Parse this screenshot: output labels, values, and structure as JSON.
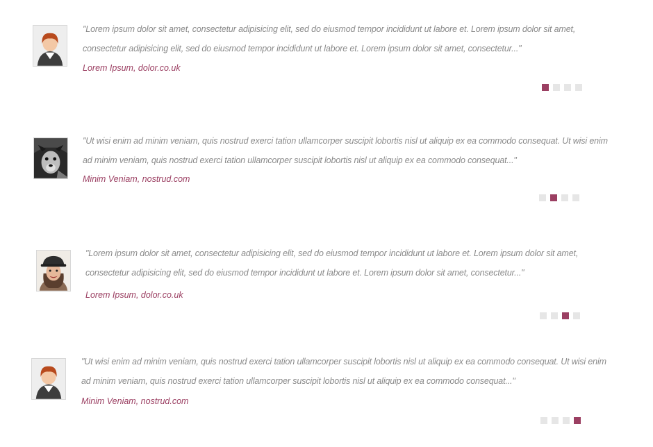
{
  "testimonials": [
    {
      "avatar_icon": "cartoon-boy-avatar-icon",
      "quote": "\"Lorem ipsum dolor sit amet, consectetur adipisicing elit, sed do eiusmod tempor incididunt ut labore et. Lorem ipsum dolor sit amet, consectetur adipisicing elit, sed do eiusmod tempor incididunt ut labore et. Lorem ipsum dolor sit amet, consectetur...\"",
      "author": "Lorem Ipsum, dolor.co.uk",
      "active_slide": 1
    },
    {
      "avatar_icon": "dog-photo-avatar-icon",
      "quote": "\"Ut wisi enim ad minim veniam, quis nostrud exerci tation ullamcorper suscipit lobortis nisl ut aliquip ex ea commodo consequat. Ut wisi enim ad minim veniam, quis nostrud exerci tation ullamcorper suscipit lobortis nisl ut aliquip ex ea commodo consequat...\"",
      "author": "Minim Veniam, nostrud.com",
      "active_slide": 2
    },
    {
      "avatar_icon": "person-with-hat-avatar-icon",
      "quote": "\"Lorem ipsum dolor sit amet, consectetur adipisicing elit, sed do eiusmod tempor incididunt ut labore et. Lorem ipsum dolor sit amet, consectetur adipisicing elit, sed do eiusmod tempor incididunt ut labore et. Lorem ipsum dolor sit amet, consectetur...\"",
      "author": "Lorem Ipsum, dolor.co.uk",
      "active_slide": 3
    },
    {
      "avatar_icon": "cartoon-boy-avatar-icon",
      "quote": "\"Ut wisi enim ad minim veniam, quis nostrud exerci tation ullamcorper suscipit lobortis nisl ut aliquip ex ea commodo consequat. Ut wisi enim ad minim veniam, quis nostrud exerci tation ullamcorper suscipit lobortis nisl ut aliquip ex ea commodo consequat...\"",
      "author": "Minim Veniam, nostrud.com",
      "active_slide": 4
    }
  ],
  "slide_count": 4,
  "colors": {
    "accent": "#9b3f62",
    "quote_text": "#8a8a8a",
    "inactive_dot": "#e6e6e6"
  }
}
